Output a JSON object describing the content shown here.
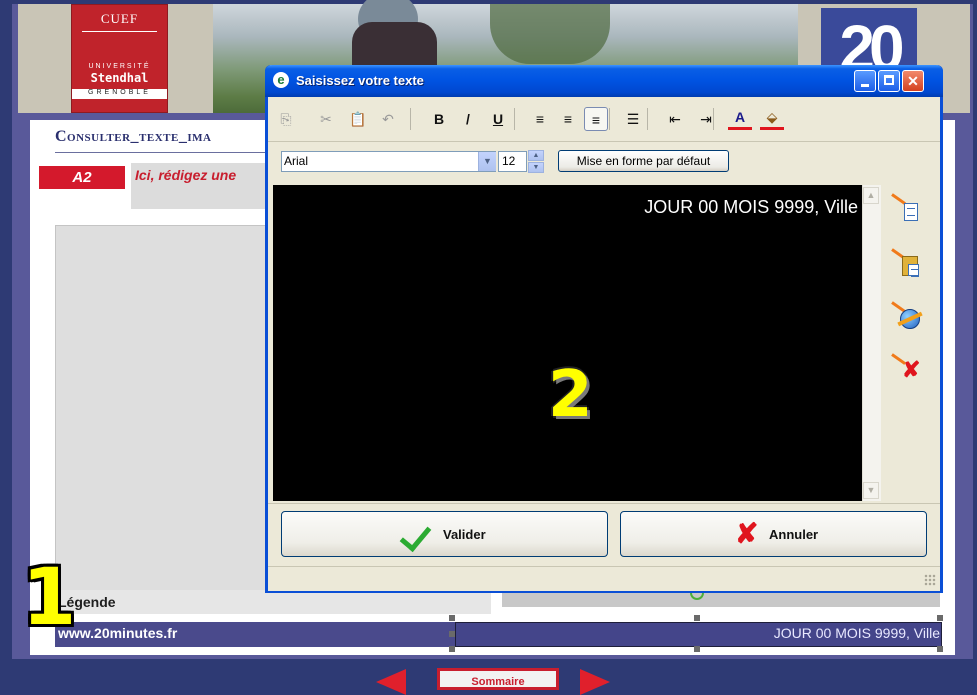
{
  "banner": {
    "cuef_logo": {
      "line1": "CUEF",
      "line2": "UNIVERSITÉ",
      "line3": "Stendhal",
      "line4": "GRENOBLE"
    },
    "logo_20": "20"
  },
  "page": {
    "section_title": "Consulter_texte_ima",
    "badge": "A2",
    "instruction": "Ici, rédigez une",
    "legend_label": "Légende",
    "source_text": "www.20minutes.fr",
    "date_text": "JOUR 00 MOIS 9999, Ville",
    "annotation_1": "1",
    "nav": {
      "home_label": "Sommaire"
    }
  },
  "dialog": {
    "title": "Saisissez votre texte",
    "title_icon": "e",
    "toolbar": {
      "items": [
        {
          "icon": "copy-icon",
          "glyph": "⎘",
          "enabled": false
        },
        {
          "icon": "cut-icon",
          "glyph": "✂",
          "enabled": false
        },
        {
          "icon": "paste-icon",
          "glyph": "📋",
          "enabled": true
        },
        {
          "icon": "undo-icon",
          "glyph": "↶",
          "enabled": false
        },
        {
          "icon": "bold-icon",
          "glyph": "B",
          "enabled": true
        },
        {
          "icon": "italic-icon",
          "glyph": "/",
          "enabled": true
        },
        {
          "icon": "underline-icon",
          "glyph": "U",
          "enabled": true
        },
        {
          "icon": "align-left-icon",
          "glyph": "≡",
          "enabled": true
        },
        {
          "icon": "align-center-icon",
          "glyph": "≡",
          "enabled": true
        },
        {
          "icon": "align-right-icon",
          "glyph": "≡",
          "enabled": true,
          "active": true
        },
        {
          "icon": "bullet-list-icon",
          "glyph": "☰",
          "enabled": true
        },
        {
          "icon": "outdent-icon",
          "glyph": "⇤",
          "enabled": true
        },
        {
          "icon": "indent-icon",
          "glyph": "⇥",
          "enabled": true
        },
        {
          "icon": "font-color-icon",
          "glyph": "A",
          "enabled": true
        },
        {
          "icon": "highlight-icon",
          "glyph": "⬙",
          "enabled": true
        }
      ]
    },
    "font_family": "Arial",
    "font_size": "12",
    "default_format_label": "Mise en forme par défaut",
    "editor_text": "JOUR 00 MOIS 9999, Ville",
    "annotation_2": "2",
    "side_icons": [
      "insert-text-icon",
      "paste-special-icon",
      "insert-link-icon",
      "clear-icon"
    ],
    "ok_label": "Valider",
    "cancel_label": "Annuler"
  },
  "colors": {
    "titlebar": "#0054e3",
    "badge": "#d4192c",
    "annotation": "#ffff00",
    "source_bar": "#4a4a8c"
  }
}
